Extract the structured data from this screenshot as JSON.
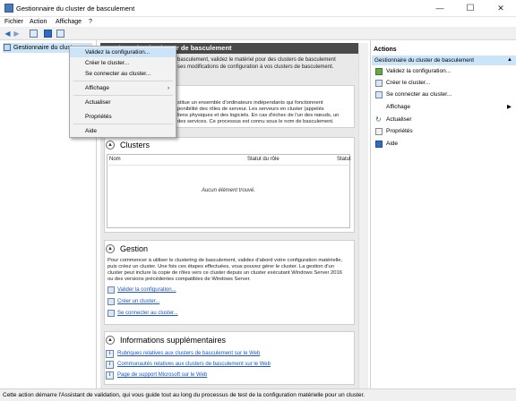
{
  "window": {
    "title": "Gestionnaire du cluster de basculement",
    "minimize": "—",
    "maximize": "☐",
    "close": "✕"
  },
  "menu": {
    "items": [
      "Fichier",
      "Action",
      "Affichage",
      "?"
    ]
  },
  "toolbar": {
    "back_icon": "arrow-left-icon",
    "forward_icon": "arrow-right-icon"
  },
  "tree": {
    "root_label": "Gestionnaire du cluster de basculement"
  },
  "center": {
    "header": "Gestionnaire du cluster de basculement",
    "intro_line1": "basculement, validez le matériel pour des clusters de basculement",
    "intro_line2": "ses modifications de configuration à vos clusters de basculement.",
    "description": [
      "stitue un ensemble d'ordinateurs indépendants qui fonctionnent",
      "ponibilité des rôles de serveur. Les serveurs en cluster (appelés",
      "liens physiques et des logiciels. En cas d'échec de l'un des nœuds, un",
      "des services. Ce processus est connu sous le nom de basculement."
    ],
    "clusters": {
      "title": "Clusters",
      "columns": [
        "Nom",
        "Statut du rôle",
        "Statut"
      ],
      "empty": "Aucun élément trouvé."
    },
    "management": {
      "title": "Gestion",
      "text": [
        "Pour commencer à utiliser le clustering de basculement, validez d'abord votre configuration matérielle,",
        "puis créez un cluster. Une fois ces étapes effectuées, vous pouvez gérer le cluster. La gestion d'un",
        "cluster peut inclure la copie de rôles vers ce cluster depuis un cluster exécutant Windows Server 2016",
        "ou des versions précédentes compatibles de Windows Server."
      ],
      "links": [
        "Valider la configuration...",
        "Créer un cluster...",
        "Se connecter au cluster..."
      ]
    },
    "more_info": {
      "title": "Informations supplémentaires",
      "links": [
        "Rubriques relatives aux clusters de basculement sur le Web",
        "Communautés relatives aux clusters de basculement sur le Web",
        "Page de support Microsoft sur le Web"
      ]
    }
  },
  "actions": {
    "title": "Actions",
    "group": "Gestionnaire du cluster de basculement",
    "items": [
      "Validez la configuration...",
      "Créer le cluster...",
      "Se connecter au cluster...",
      "Affichage",
      "Actualiser",
      "Propriétés",
      "Aide"
    ]
  },
  "context_menu": {
    "items": [
      "Validez la configuration...",
      "Créer le cluster...",
      "Se connecter au cluster...",
      "Affichage",
      "Actualiser",
      "Propriétés",
      "Aide"
    ]
  },
  "statusbar": {
    "text": "Cette action démarre l'Assistant de validation, qui vous guide tout au long du processus de test de la configuration matérielle pour un cluster."
  },
  "colors": {
    "selection": "#cce4f7",
    "header_bg": "#4a4a4a",
    "link": "#1a55c2"
  }
}
